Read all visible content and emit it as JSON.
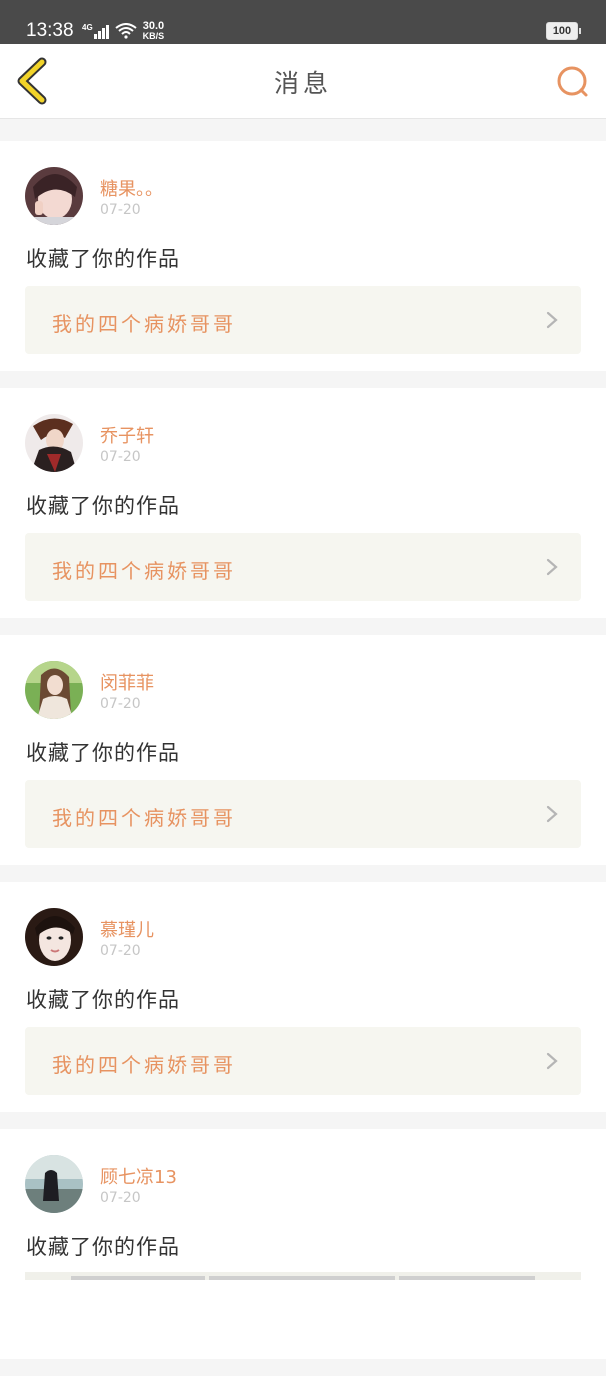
{
  "status_bar": {
    "time": "13:38",
    "network": "4G",
    "speed_value": "30.0",
    "speed_unit": "KB/S",
    "battery": "100"
  },
  "header": {
    "title": "消息",
    "back_icon": "chevron-left-icon",
    "search_icon": "search-icon"
  },
  "colors": {
    "accent": "#e79361",
    "back_icon_fill": "#f2d42a",
    "card_link_bg": "#f6f6f0"
  },
  "messages": [
    {
      "name": "糖果。。",
      "date": "07-20",
      "action": "收藏了你的作品",
      "work_title": "我的四个病娇哥哥"
    },
    {
      "name": "乔子轩",
      "date": "07-20",
      "action": "收藏了你的作品",
      "work_title": "我的四个病娇哥哥"
    },
    {
      "name": "闵菲菲",
      "date": "07-20",
      "action": "收藏了你的作品",
      "work_title": "我的四个病娇哥哥"
    },
    {
      "name": "慕瑾儿",
      "date": "07-20",
      "action": "收藏了你的作品",
      "work_title": "我的四个病娇哥哥"
    },
    {
      "name": "顾七凉13",
      "date": "07-20",
      "action": "收藏了你的作品",
      "work_title": ""
    }
  ]
}
